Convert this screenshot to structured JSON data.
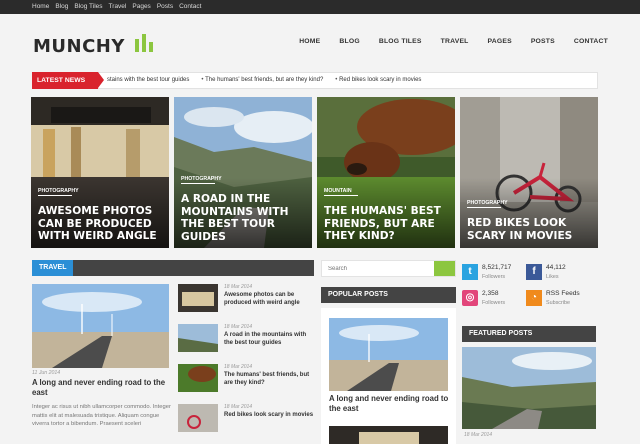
{
  "topbar": {
    "links": [
      "Home",
      "Blog",
      "Blog Tiles",
      "Travel",
      "Pages",
      "Posts",
      "Contact"
    ]
  },
  "header": {
    "logo_text": "MUNCHY",
    "nav": [
      "HOME",
      "BLOG",
      "BLOG TILES",
      "TRAVEL",
      "PAGES",
      "POSTS",
      "CONTACT"
    ]
  },
  "ticker": {
    "label": "LATEST NEWS",
    "items": [
      "stains with the best tour guides",
      "The humans' best friends, but are they kind?",
      "Red bikes look scary in movies"
    ]
  },
  "hero": [
    {
      "category": "PHOTOGRAPHY",
      "title": "AWESOME PHOTOS CAN BE PRODUCED WITH WEIRD ANGLE"
    },
    {
      "category": "PHOTOGRAPHY",
      "title": "A ROAD IN THE MOUNTAINS WITH THE BEST TOUR GUIDES"
    },
    {
      "category": "MOUNTAIN",
      "title": "THE HUMANS' BEST FRIENDS, BUT ARE THEY KIND?"
    },
    {
      "category": "PHOTOGRAPHY",
      "title": "RED BIKES LOOK SCARY IN MOVIES"
    }
  ],
  "travel": {
    "heading": "TRAVEL",
    "main": {
      "date": "11 Jun 2014",
      "title": "A long and never ending road to the east",
      "excerpt": "Integer ac risus ut nibh ullamcorper commodo. Integer mattis elit at malesuada tristique. Aliquam congue viverra tortor a bibendum. Praesent sceleri"
    },
    "list": [
      {
        "date": "18 Mar 2014",
        "title": "Awesome photos can be produced with weird angle"
      },
      {
        "date": "18 Mar 2014",
        "title": "A road in the mountains with the best tour guides"
      },
      {
        "date": "18 Mar 2014",
        "title": "The humans' best friends, but are they kind?"
      },
      {
        "date": "18 Mar 2014",
        "title": "Red bikes look scary in movies"
      }
    ]
  },
  "search": {
    "placeholder": "Search"
  },
  "popular": {
    "heading": "POPULAR POSTS",
    "post_title": "A long and never ending road to the east"
  },
  "social": [
    {
      "value": "8,521,717",
      "label": "Followers",
      "icon": "twitter-icon",
      "color": "#2aa3e0"
    },
    {
      "value": "44,112",
      "label": "Likes",
      "icon": "facebook-icon",
      "color": "#3b5998"
    },
    {
      "value": "2,358",
      "label": "Followers",
      "icon": "dribbble-icon",
      "color": "#e2457a"
    },
    {
      "value": "RSS Feeds",
      "label": "Subscribe",
      "icon": "rss-icon",
      "color": "#f08a1c"
    }
  ],
  "featured": {
    "heading": "FEATURED POSTS",
    "date": "18 Mar 2014"
  },
  "colors": {
    "accent": "#8cc63f",
    "latest_news": "#d9232d",
    "travel": "#2b8fd6",
    "dark": "#444444"
  }
}
